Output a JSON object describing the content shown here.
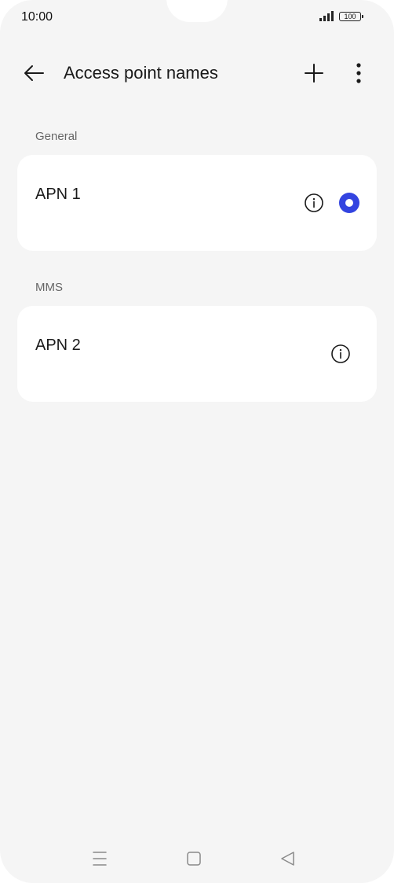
{
  "status_bar": {
    "time": "10:00",
    "battery_level": "100",
    "signal_icon": "signal-bars-icon"
  },
  "header": {
    "title": "Access point names",
    "back_icon": "arrow-left-icon",
    "add_icon": "plus-icon",
    "more_icon": "more-vert-icon"
  },
  "sections": [
    {
      "label": "General",
      "items": [
        {
          "name": "APN 1",
          "selected": true
        }
      ]
    },
    {
      "label": "MMS",
      "items": [
        {
          "name": "APN 2",
          "selected": false
        }
      ]
    }
  ],
  "colors": {
    "accent": "#3344e0",
    "background": "#f5f5f5",
    "card": "#ffffff"
  },
  "nav_bar": {
    "icons": [
      "menu-icon",
      "home-icon",
      "back-triangle-icon"
    ]
  }
}
